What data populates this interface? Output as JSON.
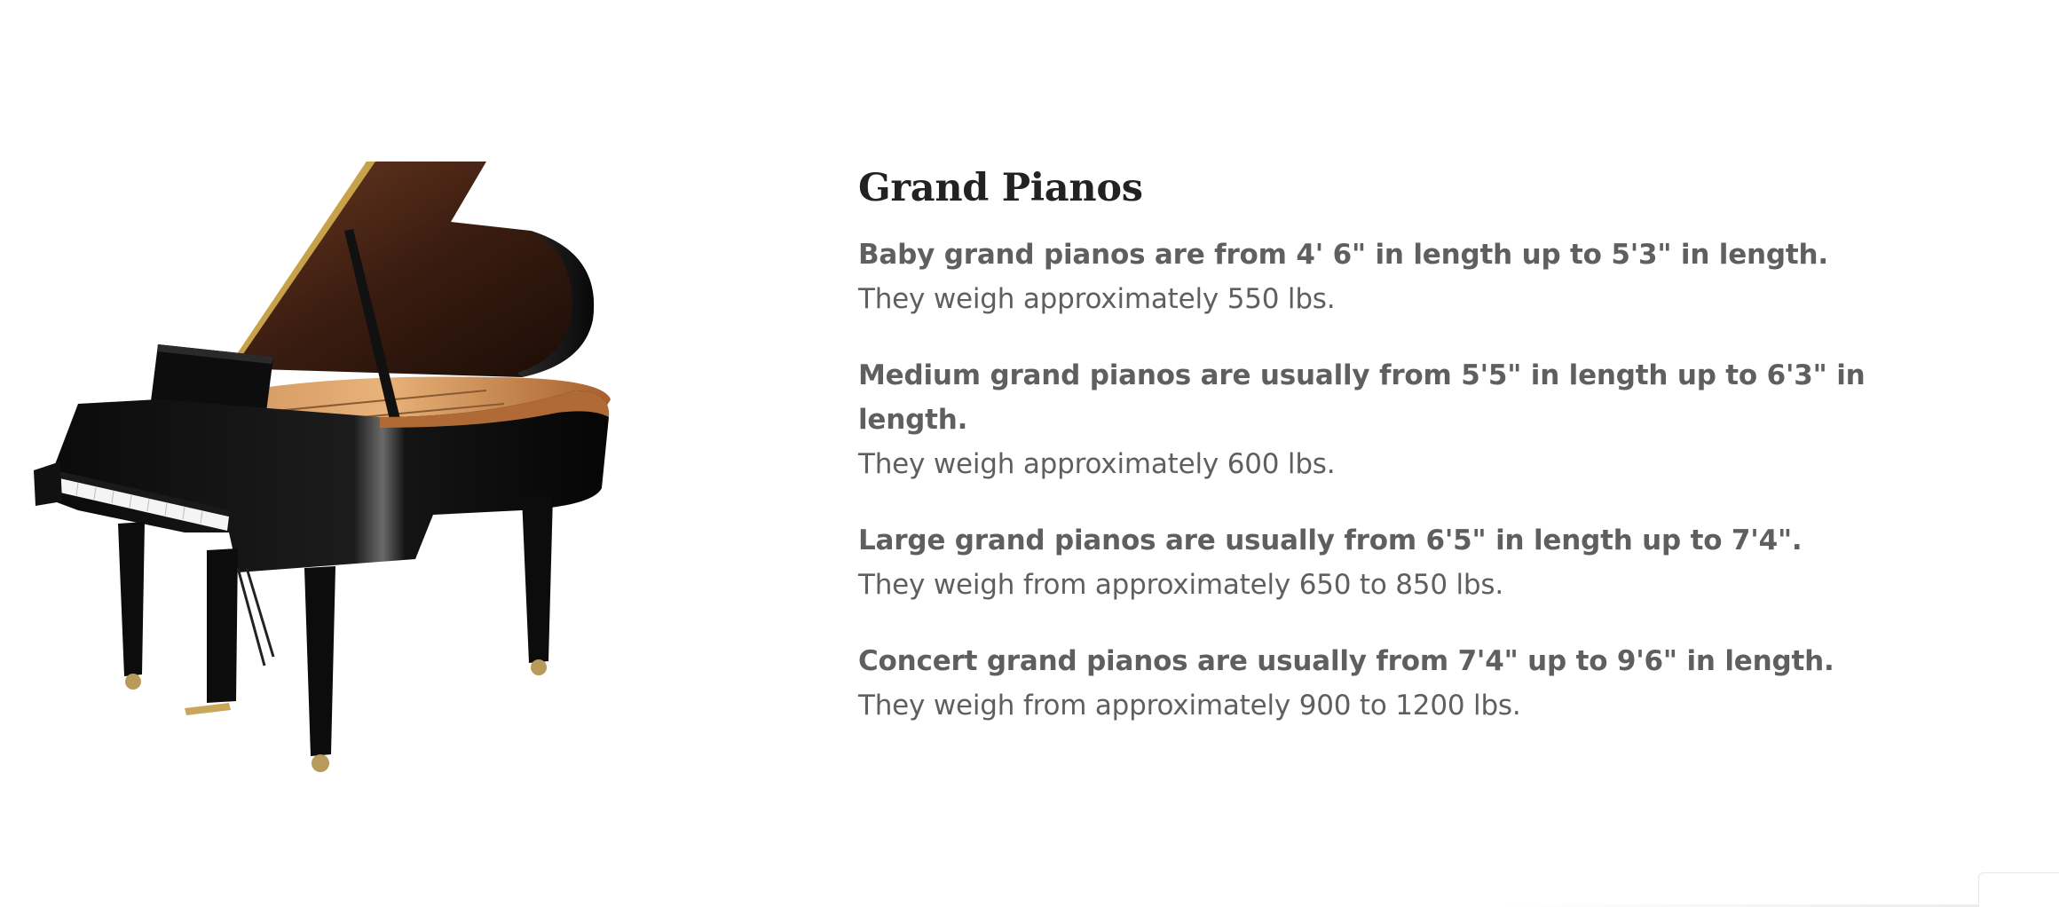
{
  "section": {
    "title": "Grand Pianos"
  },
  "entries": [
    {
      "title": "Baby grand pianos are from 4' 6\" in length up to 5'3\" in length.",
      "detail": "They weigh approximately 550 lbs."
    },
    {
      "title": "Medium grand pianos are usually from 5'5\" in length up to 6'3\" in length.",
      "detail": "They weigh approximately 600 lbs."
    },
    {
      "title": "Large grand pianos are usually from 6'5\" in length up to 7'4\".",
      "detail": "They weigh from approximately 650 to 850 lbs."
    },
    {
      "title": "Concert grand pianos are usually from 7'4\" up to 9'6\" in length.",
      "detail": "They weigh from approximately 900 to 1200 lbs."
    }
  ],
  "image": {
    "icon": "grand-piano-image"
  },
  "colors": {
    "heading": "#222222",
    "body_text": "#5f5f5f",
    "background": "#ffffff"
  }
}
